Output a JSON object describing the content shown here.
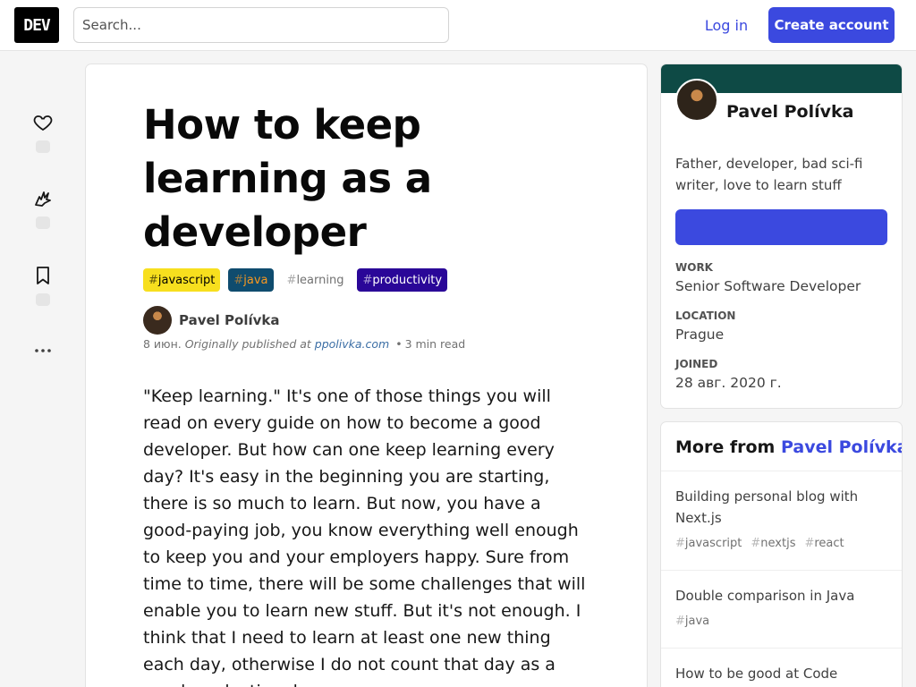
{
  "header": {
    "logo": "DEV",
    "search_placeholder": "Search...",
    "login": "Log in",
    "create_account": "Create account"
  },
  "reactions": [
    "heart-icon",
    "unicorn-icon",
    "bookmark-icon",
    "more-horizontal-icon"
  ],
  "article": {
    "title": "How to keep learning as a developer",
    "tags": [
      {
        "name": "javascript",
        "bg": "#f7df1e",
        "fg": "#000000"
      },
      {
        "name": "java",
        "bg": "#0f4c6e",
        "fg": "#f89820"
      },
      {
        "name": "learning",
        "bg": "#ffffff",
        "fg": "#717171"
      },
      {
        "name": "productivity",
        "bg": "#2a0798",
        "fg": "#ffffff"
      }
    ],
    "author": "Pavel Polívka",
    "date": "8 июн.",
    "originally": "Originally published at",
    "source": "ppolivka.com",
    "read_time": "3 min read",
    "body": "\"Keep learning.\" It's one of those things you will read on every guide on how to become a good developer. But how can one keep learning every day? It's easy in the beginning you are starting, there is so much to learn. But now, you have a good-paying job, you know everything well enough to keep you and your employers happy. Sure from time to time, there will be some challenges that will enable you to learn new stuff. But it's not enough. I think that I need to learn at least one new thing each day, otherwise I do not count that day as a good productive day."
  },
  "profile": {
    "name": "Pavel Polívka",
    "bio": "Father, developer, bad sci-fi writer, love to learn stuff",
    "work_label": "WORK",
    "work": "Senior Software Developer",
    "location_label": "LOCATION",
    "location": "Prague",
    "joined_label": "JOINED",
    "joined": "28 авг. 2020 г."
  },
  "more_from": {
    "heading": "More from",
    "author": "Pavel Polívka",
    "posts": [
      {
        "title": "Building personal blog with Next.js",
        "tags": [
          "javascript",
          "nextjs",
          "react"
        ]
      },
      {
        "title": "Double comparison in Java",
        "tags": [
          "java"
        ]
      },
      {
        "title": "How to be good at Code Reviews",
        "tags": []
      }
    ]
  },
  "colors": {
    "accent": "#3b49df",
    "profile_band": "#0e4a45"
  }
}
